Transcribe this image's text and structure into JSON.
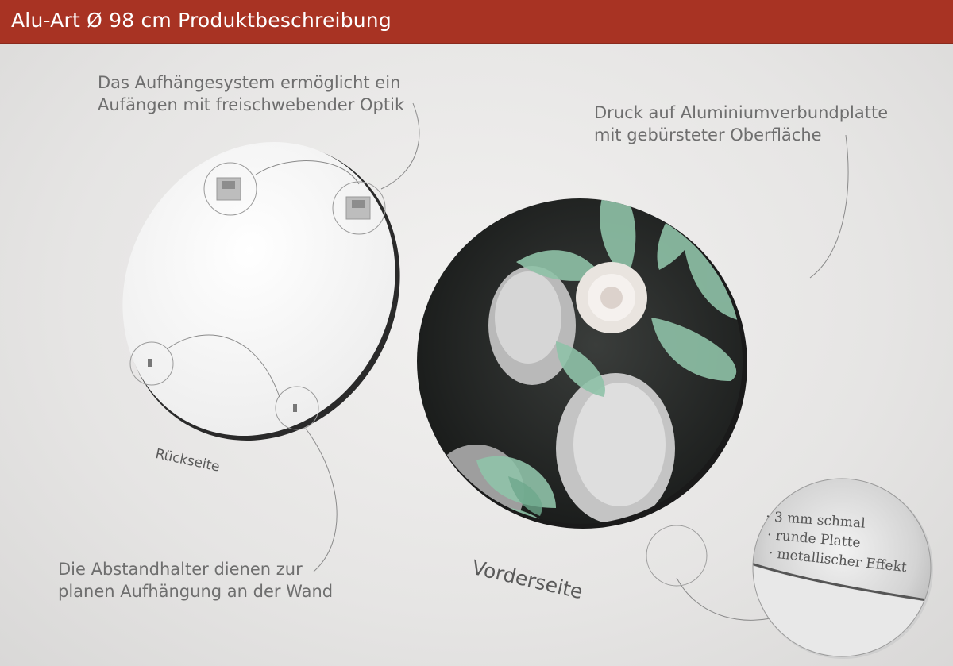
{
  "header": {
    "title": "Alu-Art Ø 98 cm Produktbeschreibung"
  },
  "captions": {
    "hanging_system": {
      "line1": "Das Aufhängesystem ermöglicht ein",
      "line2": "Aufängen mit freischwebender Optik"
    },
    "print": {
      "line1": "Druck auf Aluminiumverbundplatte",
      "line2": "mit gebürsteter Oberfläche"
    },
    "spacers": {
      "line1": "Die Abstandhalter dienen zur",
      "line2": "planen Aufhängung an der Wand"
    }
  },
  "labels": {
    "back": "Rückseite",
    "front": "Vorderseite"
  },
  "features": [
    "· 3 mm schmal",
    "· runde Platte",
    "· metallischer Effekt"
  ],
  "colors": {
    "header": "#a83323",
    "caption_text": "#6e6e6e",
    "leaf_green": "#8fc2a8"
  }
}
